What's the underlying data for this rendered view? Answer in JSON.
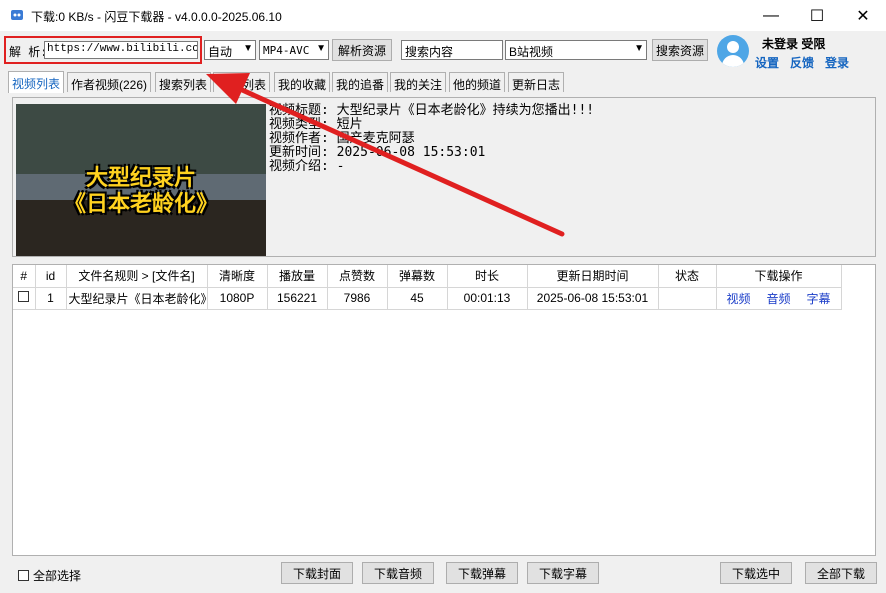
{
  "window": {
    "title": "下载:0 KB/s - 闪豆下载器 - v4.0.0.0-2025.06.10",
    "minimize": "—",
    "maximize": "☐",
    "close": "✕"
  },
  "toolbar": {
    "parse_label": "解 析:",
    "url_value": "https://www.bilibili.com/",
    "quality_select": "自动",
    "format_select": "MP4-AVC",
    "parse_button": "解析资源",
    "search_input": "搜索内容",
    "source_select": "B站视频",
    "search_button": "搜索资源"
  },
  "user": {
    "status": "未登录  受限",
    "settings": "设置",
    "feedback": "反馈",
    "login": "登录"
  },
  "tabs": [
    {
      "label": "视频列表"
    },
    {
      "label": "作者视频(226)"
    },
    {
      "label": "搜索列表"
    },
    {
      "label": "列表"
    },
    {
      "label": "我的收藏"
    },
    {
      "label": "我的追番"
    },
    {
      "label": "我的关注"
    },
    {
      "label": "他的频道"
    },
    {
      "label": "更新日志"
    }
  ],
  "video": {
    "thumbnail_caption_1": "大型纪录片",
    "thumbnail_caption_2": "《日本老龄化》",
    "title_line": "视频标题: 大型纪录片《日本老龄化》持续为您播出!!!",
    "type_line": "视频类型: 短片",
    "author_line": "视频作者: 国产麦克阿瑟",
    "updated_line": "更新时间: 2025-06-08 15:53:01",
    "intro_line": "视频介绍: -"
  },
  "table": {
    "headers": [
      "#",
      "id",
      "文件名规则  >  [文件名]",
      "清晰度",
      "播放量",
      "点赞数",
      "弹幕数",
      "时长",
      "更新日期时间",
      "状态",
      "下载操作"
    ],
    "rows": [
      {
        "id": "1",
        "filename": "大型纪录片《日本老龄化》",
        "quality": "1080P",
        "plays": "156221",
        "likes": "7986",
        "danmaku": "45",
        "duration": "00:01:13",
        "updated": "2025-06-08 15:53:01",
        "status": "",
        "op_video": "视频",
        "op_audio": "音频",
        "op_subtitle": "字幕"
      }
    ]
  },
  "bottom": {
    "select_all": "全部选择",
    "download_cover": "下载封面",
    "download_audio": "下载音频",
    "download_danmaku": "下载弹幕",
    "download_subtitle": "下载字幕",
    "download_selected": "下载选中",
    "download_all": "全部下载"
  },
  "colors": {
    "annotation_red": "#e02020",
    "link_blue": "#1565c0",
    "caption_yellow": "#ffd21f"
  }
}
